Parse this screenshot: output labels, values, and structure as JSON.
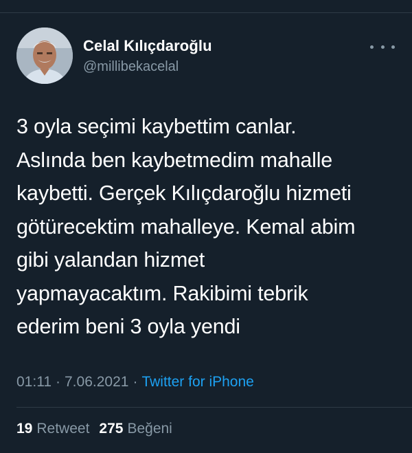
{
  "author": {
    "display_name": "Celal Kılıçdaroğlu",
    "handle": "@millibekacelal"
  },
  "tweet": {
    "lines": [
      "3 oyla seçimi kaybettim canlar.",
      "Aslında ben kaybetmedim mahalle",
      "kaybetti. Gerçek Kılıçdaroğlu hizmeti",
      "götürecektim mahalleye. Kemal abim",
      "gibi yalandan hizmet",
      "yapmayacaktım. Rakibimi tebrik",
      "ederim beni 3 oyla yendi"
    ]
  },
  "meta": {
    "time": "01:11",
    "separator": "·",
    "date": "7.06.2021",
    "source": "Twitter for iPhone"
  },
  "stats": {
    "retweets_count": "19",
    "retweets_label": "Retweet",
    "likes_count": "275",
    "likes_label": "Beğeni"
  },
  "icons": {
    "more": "more-options-icon"
  },
  "colors": {
    "background": "#15202b",
    "text": "#ffffff",
    "secondary": "#8899a6",
    "accent": "#1da1f2"
  }
}
